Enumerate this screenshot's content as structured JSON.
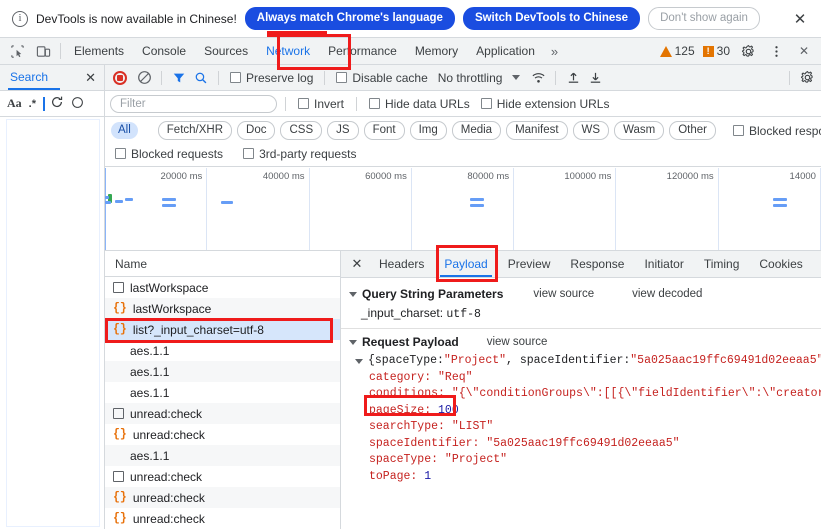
{
  "infobar": {
    "icon": "info-circle-icon",
    "message": "DevTools is now available in Chinese!",
    "primary_button": "Always match Chrome's language",
    "secondary_button": "Switch DevTools to Chinese",
    "dismiss_button": "Don't show again",
    "close_icon": "✕"
  },
  "tabstrip": {
    "inspect_icon": "inspect-element-icon",
    "device_icon": "device-toolbar-icon",
    "tabs": [
      {
        "label": "Elements",
        "active": false
      },
      {
        "label": "Console",
        "active": false
      },
      {
        "label": "Sources",
        "active": false
      },
      {
        "label": "Network",
        "active": true
      },
      {
        "label": "Performance",
        "active": false
      },
      {
        "label": "Memory",
        "active": false
      },
      {
        "label": "Application",
        "active": false
      }
    ],
    "more_tabs": "»",
    "warning_count": "125",
    "error_count": "30",
    "error_glyph": "!",
    "settings_icon": "gear-icon",
    "menu_icon": "kebab-menu-icon",
    "close_icon": "✕"
  },
  "search_panel": {
    "tab_label": "Search",
    "close_icon": "✕",
    "match_case_label": "Aa",
    "regex_label": ".*",
    "refresh_icon": "refresh-icon",
    "clear_icon": "clear-icon"
  },
  "network_toolbar": {
    "record_icon": "record-stop-icon",
    "clear_icon": "clear-network-log-icon",
    "filter_icon": "filter-funnel-icon",
    "search_icon": "search-icon",
    "preserve_log": "Preserve log",
    "disable_cache": "Disable cache",
    "throttling": "No throttling",
    "throttle_caret": "▼",
    "wifi_icon": "network-conditions-icon",
    "import_icon": "import-har-icon",
    "export_icon": "export-har-icon",
    "settings_icon": "network-settings-gear-icon"
  },
  "filter_bar": {
    "filter_placeholder": "Filter",
    "filter_value": "",
    "invert": "Invert",
    "hide_data_urls": "Hide data URLs",
    "hide_extension_urls": "Hide extension URLs"
  },
  "type_filters": {
    "chips": [
      {
        "label": "All",
        "selected": true
      },
      {
        "label": "Fetch/XHR",
        "selected": false
      },
      {
        "label": "Doc",
        "selected": false
      },
      {
        "label": "CSS",
        "selected": false
      },
      {
        "label": "JS",
        "selected": false
      },
      {
        "label": "Font",
        "selected": false
      },
      {
        "label": "Img",
        "selected": false
      },
      {
        "label": "Media",
        "selected": false
      },
      {
        "label": "Manifest",
        "selected": false
      },
      {
        "label": "WS",
        "selected": false
      },
      {
        "label": "Wasm",
        "selected": false
      },
      {
        "label": "Other",
        "selected": false
      }
    ],
    "blocked_response_cookies": "Blocked response cookies",
    "blocked_requests": "Blocked requests",
    "third_party_requests": "3rd-party requests"
  },
  "overview": {
    "ticks": [
      "20000 ms",
      "40000 ms",
      "60000 ms",
      "80000 ms",
      "100000 ms",
      "120000 ms",
      "14000"
    ]
  },
  "request_table": {
    "column_name": "Name",
    "rows": [
      {
        "icon": "document-icon",
        "name": "lastWorkspace",
        "selected": false
      },
      {
        "icon": "json-icon",
        "name": "lastWorkspace",
        "selected": false
      },
      {
        "icon": "json-icon",
        "name": "list?_input_charset=utf-8",
        "selected": true
      },
      {
        "icon": "none",
        "name": "aes.1.1",
        "selected": false
      },
      {
        "icon": "none",
        "name": "aes.1.1",
        "selected": false
      },
      {
        "icon": "none",
        "name": "aes.1.1",
        "selected": false
      },
      {
        "icon": "document-icon",
        "name": "unread:check",
        "selected": false
      },
      {
        "icon": "json-icon",
        "name": "unread:check",
        "selected": false
      },
      {
        "icon": "none",
        "name": "aes.1.1",
        "selected": false
      },
      {
        "icon": "document-icon",
        "name": "unread:check",
        "selected": false
      },
      {
        "icon": "json-icon",
        "name": "unread:check",
        "selected": false
      },
      {
        "icon": "json-icon",
        "name": "unread:check",
        "selected": false
      }
    ]
  },
  "detail_panel": {
    "close_icon": "✕",
    "tabs": [
      {
        "label": "Headers",
        "active": false
      },
      {
        "label": "Payload",
        "active": true
      },
      {
        "label": "Preview",
        "active": false
      },
      {
        "label": "Response",
        "active": false
      },
      {
        "label": "Initiator",
        "active": false
      },
      {
        "label": "Timing",
        "active": false
      },
      {
        "label": "Cookies",
        "active": false
      }
    ],
    "query_section": {
      "title": "Query String Parameters",
      "view_source": "view source",
      "view_decoded": "view decoded",
      "param_key": "_input_charset:",
      "param_value": "utf-8"
    },
    "payload_section": {
      "title": "Request Payload",
      "view_source": "view source",
      "root_line": "{spaceType: \"Project\", spaceIdentifier: \"5a025aac19ffc69491d02eeaa5\"",
      "root_prefix": "{spaceType: ",
      "root_v1": "\"Project\"",
      "root_mid": ", spaceIdentifier: ",
      "root_v2": "\"5a025aac19ffc69491d02eeaa5\"",
      "entries": [
        {
          "key": "category:",
          "value": "\"Req\"",
          "type": "string"
        },
        {
          "key": "conditions:",
          "value": "\"{\\\"conditionGroups\\\":[[{\\\"fieldIdentifier\\\":\\\"creator\\\"",
          "type": "string"
        },
        {
          "key": "pageSize:",
          "value": "100",
          "type": "number"
        },
        {
          "key": "searchType:",
          "value": "\"LIST\"",
          "type": "string"
        },
        {
          "key": "spaceIdentifier:",
          "value": "\"5a025aac19ffc69491d02eeaa5\"",
          "type": "string"
        },
        {
          "key": "spaceType:",
          "value": "\"Project\"",
          "type": "string"
        },
        {
          "key": "toPage:",
          "value": "1",
          "type": "number"
        }
      ]
    }
  },
  "annotations": {
    "color": "#ef1b1b",
    "targets": [
      "always-match-language-underline",
      "network-tab",
      "selected-request-row",
      "payload-tab",
      "conditions-key"
    ]
  }
}
